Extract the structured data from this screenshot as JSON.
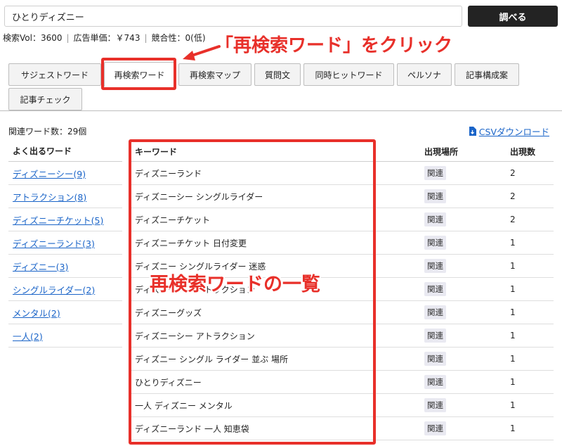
{
  "search": {
    "value": "ひとりディズニー",
    "button_label": "調べる"
  },
  "meta": {
    "volume": "検索Vol：3600",
    "ad_price": "広告単価：￥743",
    "competition": "競合性：0(低)"
  },
  "tabs": [
    {
      "label": "サジェストワード",
      "active": false
    },
    {
      "label": "再検索ワード",
      "active": true
    },
    {
      "label": "再検索マップ",
      "active": false
    },
    {
      "label": "質問文",
      "active": false
    },
    {
      "label": "同時ヒットワード",
      "active": false
    },
    {
      "label": "ペルソナ",
      "active": false
    },
    {
      "label": "記事構成案",
      "active": false
    },
    {
      "label": "記事チェック",
      "active": false
    }
  ],
  "annotations": {
    "click_note": "「再検索ワード」をクリック",
    "list_note": "再検索ワードの一覧",
    "color": "#e8302a"
  },
  "related": {
    "count_label": "関連ワード数：29個",
    "csv_label": "CSVダウンロード",
    "csv_icon": "file-download-icon"
  },
  "frequent": {
    "header": "よく出るワード",
    "items": [
      "ディズニーシー(9)",
      "アトラクション(8)",
      "ディズニーチケット(5)",
      "ディズニーランド(3)",
      "ディズニー(3)",
      "シングルライダー(2)",
      "メンタル(2)",
      "一人(2)"
    ]
  },
  "table": {
    "headers": {
      "keyword": "キーワード",
      "place": "出現場所",
      "count": "出現数"
    },
    "rows": [
      {
        "keyword": "ディズニーランド",
        "place": "関連",
        "count": "2"
      },
      {
        "keyword": "ディズニーシー シングルライダー",
        "place": "関連",
        "count": "2"
      },
      {
        "keyword": "ディズニーチケット",
        "place": "関連",
        "count": "2"
      },
      {
        "keyword": "ディズニーチケット 日付変更",
        "place": "関連",
        "count": "1"
      },
      {
        "keyword": "ディズニー シングルライダー 迷惑",
        "place": "関連",
        "count": "1"
      },
      {
        "keyword": "ディズニーシー アトラクション",
        "place": "関連",
        "count": "1"
      },
      {
        "keyword": "ディズニーグッズ",
        "place": "関連",
        "count": "1"
      },
      {
        "keyword": "ディズニーシー アトラクション",
        "place": "関連",
        "count": "1"
      },
      {
        "keyword": "ディズニー シングル ライダー 並ぶ 場所",
        "place": "関連",
        "count": "1"
      },
      {
        "keyword": "ひとりディズニー",
        "place": "関連",
        "count": "1"
      },
      {
        "keyword": "一人 ディズニー メンタル",
        "place": "関連",
        "count": "1"
      },
      {
        "keyword": "ディズニーランド 一人 知恵袋",
        "place": "関連",
        "count": "1"
      }
    ]
  }
}
